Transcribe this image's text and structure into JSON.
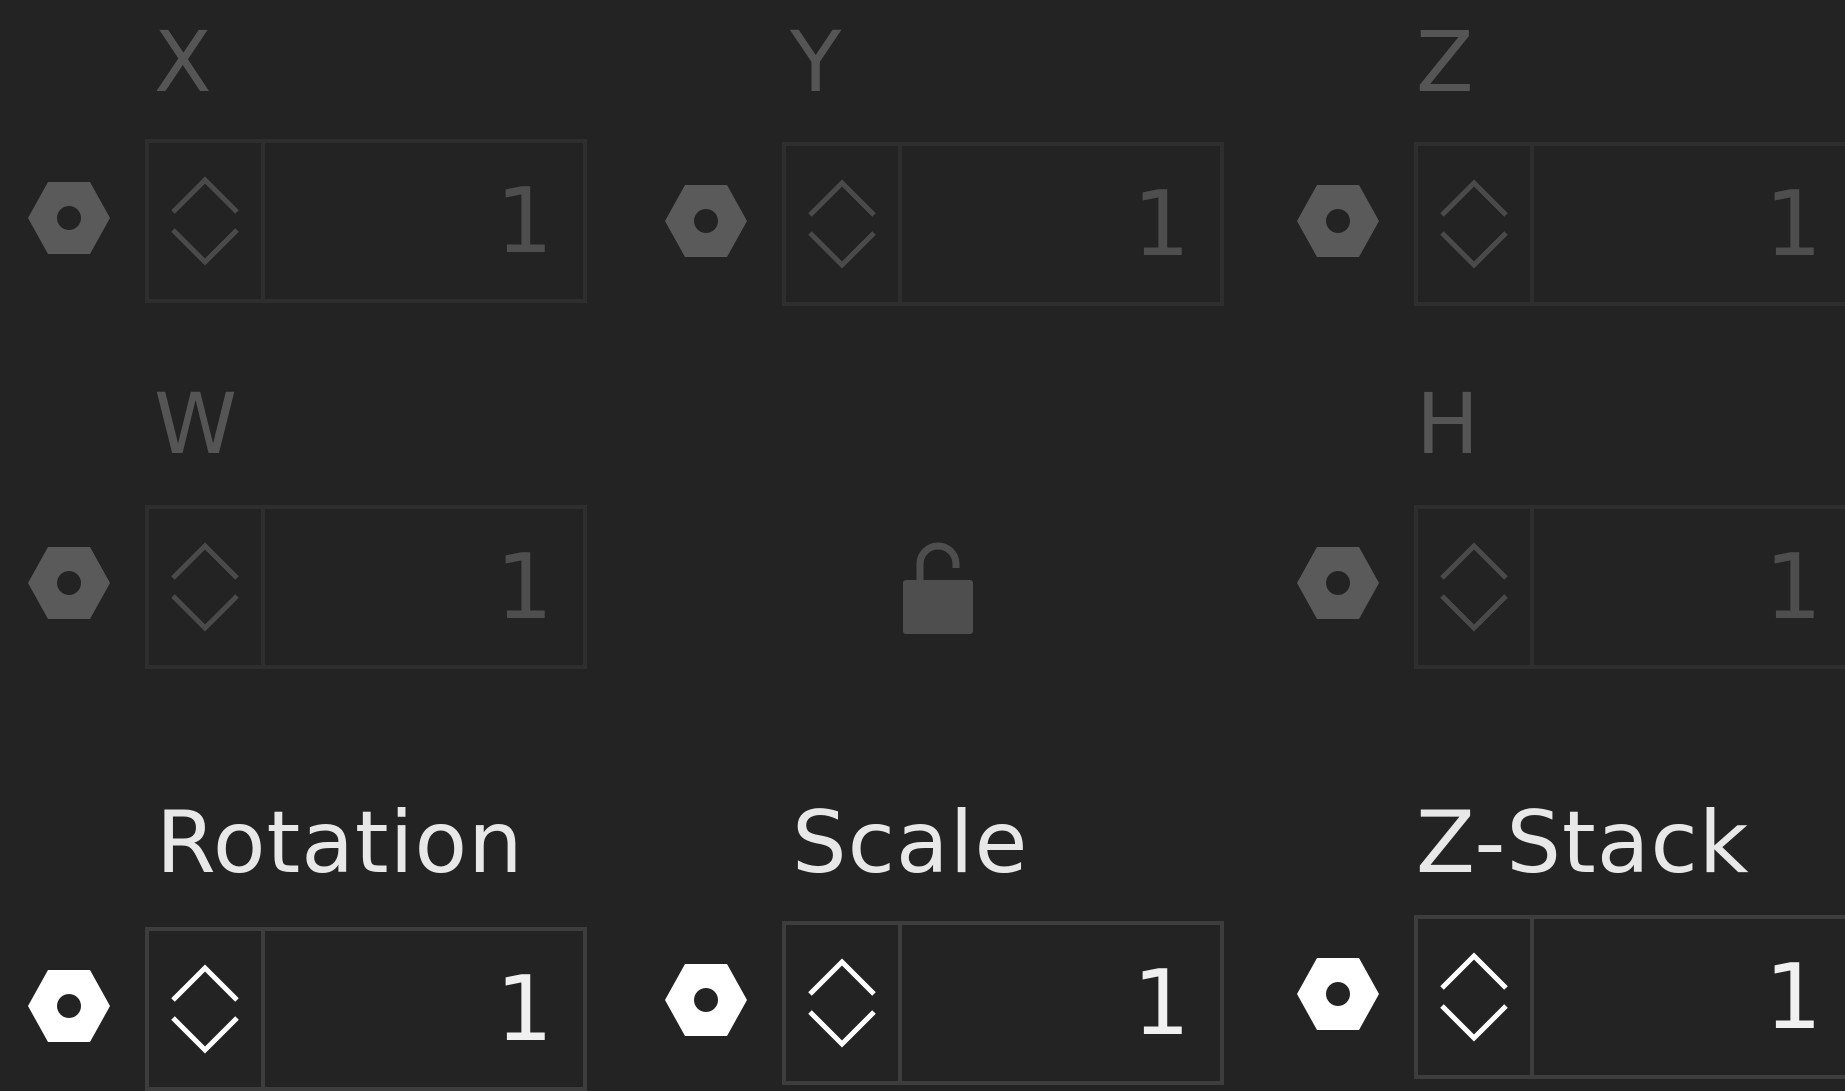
{
  "position": {
    "x": {
      "label": "X",
      "value": "1"
    },
    "y": {
      "label": "Y",
      "value": "1"
    },
    "z": {
      "label": "Z",
      "value": "1"
    }
  },
  "size": {
    "w": {
      "label": "W",
      "value": "1"
    },
    "h": {
      "label": "H",
      "value": "1"
    },
    "lock_icon": "unlocked-padlock-icon"
  },
  "transform": {
    "rotation": {
      "label": "Rotation",
      "value": "1"
    },
    "scale": {
      "label": "Scale",
      "value": "1"
    },
    "zstack": {
      "label": "Z-Stack",
      "value": "1"
    }
  },
  "colors": {
    "background": "#232323",
    "inactive_text": "#555555",
    "active_text": "#e8e8e8",
    "inactive_keyframe": "#5a5a5a",
    "active_keyframe": "#ffffff",
    "field_border": "#2e2e2e"
  },
  "icons": {
    "keyframe": "hexagon-keyframe-icon",
    "increment": "chevron-up-icon",
    "decrement": "chevron-down-icon"
  }
}
